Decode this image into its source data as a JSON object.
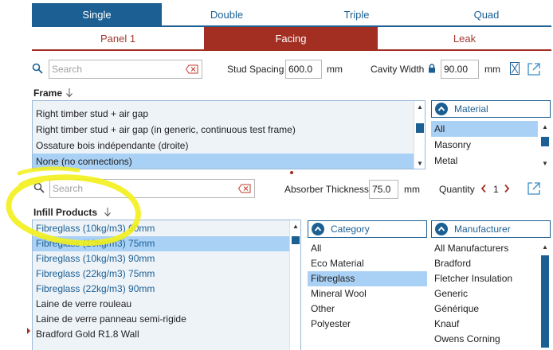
{
  "tabs_row1": [
    {
      "label": "Single",
      "active": true
    },
    {
      "label": "Double",
      "active": false
    },
    {
      "label": "Triple",
      "active": false
    },
    {
      "label": "Quad",
      "active": false
    }
  ],
  "tabs_row2": [
    {
      "label": "Panel 1",
      "active": false
    },
    {
      "label": "Facing",
      "active": true
    },
    {
      "label": "Leak",
      "active": false
    }
  ],
  "frame_section": {
    "search_placeholder": "Search",
    "stud_spacing_label": "Stud Spacing",
    "stud_spacing_value": "600.0",
    "stud_spacing_unit": "mm",
    "cavity_width_label": "Cavity Width",
    "cavity_width_value": "90.00",
    "cavity_width_unit": "mm",
    "title": "Frame",
    "items": [
      {
        "label": "Right timber stud + air gap",
        "selected": false
      },
      {
        "label": "Right timber stud + air gap (in generic, continuous test frame)",
        "selected": false
      },
      {
        "label": "Ossature bois indépendante (droite)",
        "selected": false
      },
      {
        "label": "None (no connections)",
        "selected": true
      }
    ],
    "material_header": "Material",
    "material_items": [
      {
        "label": "All",
        "selected": true
      },
      {
        "label": "Masonry",
        "selected": false
      },
      {
        "label": "Metal",
        "selected": false
      }
    ]
  },
  "infill_section": {
    "search_placeholder": "Search",
    "absorber_thickness_label": "Absorber Thickness",
    "absorber_thickness_value": "75.0",
    "absorber_thickness_unit": "mm",
    "quantity_label": "Quantity",
    "quantity_value": "1",
    "title": "Infill Products",
    "items": [
      {
        "label": "Fibreglass (10kg/m3) 60mm",
        "selected": false,
        "blue": true
      },
      {
        "label": "Fibreglass (10kg/m3) 75mm",
        "selected": true,
        "blue": true
      },
      {
        "label": "Fibreglass (10kg/m3) 90mm",
        "selected": false,
        "blue": true
      },
      {
        "label": "Fibreglass (22kg/m3) 75mm",
        "selected": false,
        "blue": true
      },
      {
        "label": "Fibreglass (22kg/m3) 90mm",
        "selected": false,
        "blue": true
      },
      {
        "label": "Laine de verre rouleau",
        "selected": false,
        "blue": false
      },
      {
        "label": "Laine de verre panneau semi-rigide",
        "selected": false,
        "blue": false
      },
      {
        "label": "Bradford Gold R1.8 Wall",
        "selected": false,
        "blue": false
      }
    ],
    "category_header": "Category",
    "category_items": [
      {
        "label": "All",
        "selected": false
      },
      {
        "label": "Eco Material",
        "selected": false
      },
      {
        "label": "Fibreglass",
        "selected": true
      },
      {
        "label": "Mineral Wool",
        "selected": false
      },
      {
        "label": "Other",
        "selected": false
      },
      {
        "label": "Polyester",
        "selected": false
      }
    ],
    "manufacturer_header": "Manufacturer",
    "manufacturer_items": [
      {
        "label": "All Manufacturers",
        "selected": false
      },
      {
        "label": "Bradford",
        "selected": false
      },
      {
        "label": "Fletcher Insulation",
        "selected": false
      },
      {
        "label": "Generic",
        "selected": false
      },
      {
        "label": "Générique",
        "selected": false
      },
      {
        "label": "Knauf",
        "selected": false
      },
      {
        "label": "Owens Corning",
        "selected": false
      }
    ]
  },
  "colors": {
    "blue": "#1b5f93",
    "red": "#a32e22",
    "selection": "#a9d1f5",
    "highlighter": "#f2f01a"
  },
  "icons": {
    "search": "search-icon",
    "clear": "clear-search-icon",
    "lock": "lock-icon",
    "external": "open-external-icon",
    "sort": "sort-down-arrow-icon",
    "chevron": "chevron-up-circle-icon"
  }
}
